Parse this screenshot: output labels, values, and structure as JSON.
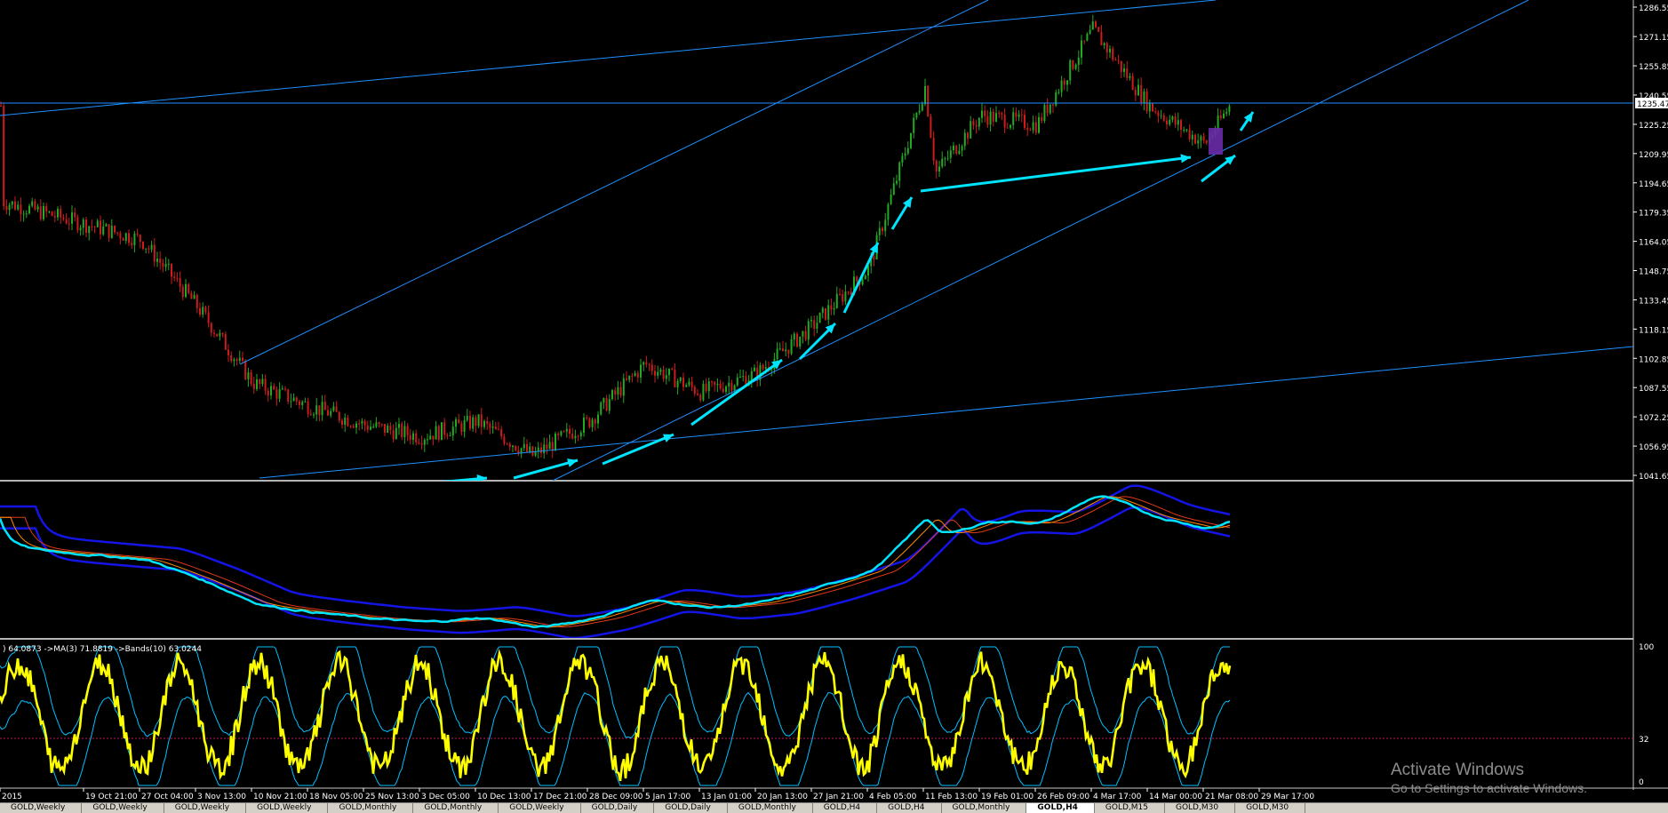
{
  "price_scale": {
    "labels": [
      "1286.55",
      "1271.15",
      "1255.85",
      "1240.55",
      "1225.25",
      "1209.95",
      "1194.65",
      "1179.35",
      "1164.05",
      "1148.75",
      "1133.45",
      "1118.15",
      "1102.85",
      "1087.55",
      "1072.25",
      "1056.95",
      "1041.65"
    ],
    "current_price": "1235.47"
  },
  "oscillator": {
    "header": ") 64.0873  ->MA(3) 71.8819  ->Bands(10) 63.0244",
    "scale_top": "100",
    "scale_level": "32",
    "scale_bottom": "0"
  },
  "time_axis": [
    "2015",
    "19 Oct 21:00",
    "27 Oct 04:00",
    "3 Nov 13:00",
    "10 Nov 21:00",
    "18 Nov 05:00",
    "25 Nov 13:00",
    "3 Dec 05:00",
    "10 Dec 13:00",
    "17 Dec 21:00",
    "28 Dec 09:00",
    "5 Jan 17:00",
    "13 Jan 01:00",
    "20 Jan 13:00",
    "27 Jan 21:00",
    "4 Feb 05:00",
    "11 Feb 13:00",
    "19 Feb 01:00",
    "26 Feb 09:00",
    "4 Mar 17:00",
    "14 Mar 00:00",
    "21 Mar 08:00",
    "29 Mar 17:00"
  ],
  "tabs": [
    "GOLD,Weekly",
    "GOLD,Weekly",
    "GOLD,Weekly",
    "GOLD,Weekly",
    "GOLD,Monthly",
    "GOLD,Monthly",
    "GOLD,Weekly",
    "GOLD,Daily",
    "GOLD,Daily",
    "GOLD,Monthly",
    "GOLD,H4",
    "GOLD,H4",
    "GOLD,Monthly",
    "GOLD,H4",
    "GOLD,M15",
    "GOLD,M30",
    "GOLD,M30"
  ],
  "active_tab_index": 13,
  "watermark": {
    "title": "Activate Windows",
    "subtitle": "Go to Settings to activate Windows."
  },
  "colors": {
    "background": "#000000",
    "bull_candle": "#22aa22",
    "bear_candle": "#cc1c1c",
    "trendline": "#1e90ff",
    "arrow": "#00e5ff",
    "bands": "#1414e6",
    "ma_fast": "#ff6a00",
    "rsi_line": "#ffff00",
    "oscillator_bands": "#00bfff"
  },
  "chart_data": {
    "type": "candlestick",
    "symbol": "GOLD",
    "timeframe": "H4",
    "y_range": [
      1041.65,
      1286.55
    ],
    "price_path": [
      {
        "date": "2015",
        "price": 1185
      },
      {
        "date": "27 Oct 04:00",
        "price": 1165
      },
      {
        "date": "3 Nov 13:00",
        "price": 1130
      },
      {
        "date": "10 Nov 21:00",
        "price": 1090
      },
      {
        "date": "18 Nov 05:00",
        "price": 1078
      },
      {
        "date": "25 Nov 13:00",
        "price": 1068
      },
      {
        "date": "3 Dec 05:00",
        "price": 1062
      },
      {
        "date": "10 Dec 13:00",
        "price": 1070
      },
      {
        "date": "17 Dec 21:00",
        "price": 1052
      },
      {
        "date": "28 Dec 09:00",
        "price": 1070
      },
      {
        "date": "5 Jan 17:00",
        "price": 1100
      },
      {
        "date": "13 Jan 01:00",
        "price": 1085
      },
      {
        "date": "20 Jan 13:00",
        "price": 1095
      },
      {
        "date": "27 Jan 21:00",
        "price": 1120
      },
      {
        "date": "4 Feb 05:00",
        "price": 1150
      },
      {
        "date": "11 Feb 13:00",
        "price": 1245
      },
      {
        "date": "11 Feb 13:00",
        "price": 1200
      },
      {
        "date": "19 Feb 01:00",
        "price": 1230
      },
      {
        "date": "26 Feb 09:00",
        "price": 1225
      },
      {
        "date": "4 Mar 17:00",
        "price": 1275
      },
      {
        "date": "14 Mar 00:00",
        "price": 1235
      },
      {
        "date": "21 Mar 08:00",
        "price": 1215
      },
      {
        "date": "29 Mar 17:00",
        "price": 1235
      }
    ],
    "horizontal_levels": [
      1235.47
    ],
    "oscillator_levels": [
      32
    ]
  }
}
